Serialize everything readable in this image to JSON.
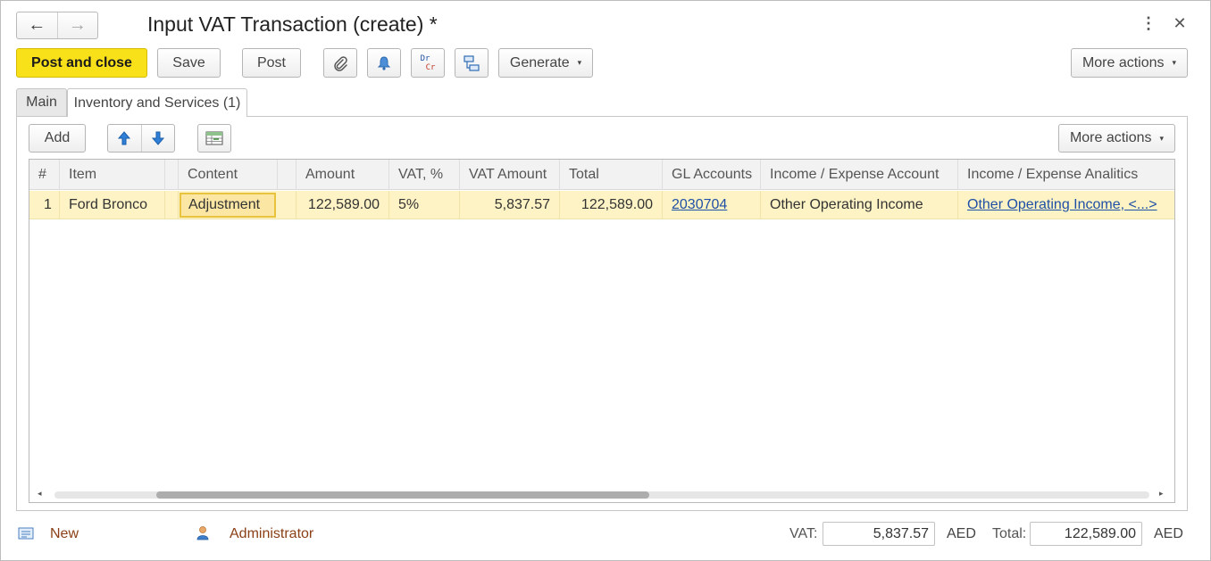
{
  "window": {
    "title": "Input VAT Transaction (create) *"
  },
  "nav": {
    "back_icon": "←",
    "forward_icon": "→",
    "more_icon": "⋮",
    "close_icon": "✕"
  },
  "toolbar": {
    "post_close": "Post and close",
    "save": "Save",
    "post": "Post",
    "dr": "Dr",
    "cr": "Cr",
    "generate": "Generate",
    "more_actions": "More actions",
    "caret": "▾"
  },
  "tabs": [
    {
      "label": "Main"
    },
    {
      "label": "Inventory and Services (1)"
    }
  ],
  "grid_toolbar": {
    "add": "Add",
    "more_actions": "More actions"
  },
  "table": {
    "headers": [
      "#",
      "Item",
      "Content",
      "Amount",
      "VAT, %",
      "VAT Amount",
      "Total",
      "GL Accounts",
      "Income / Expense Account",
      "Income / Expense Analitics"
    ],
    "rows": [
      {
        "num": "1",
        "item": "Ford Bronco",
        "content": "Adjustment",
        "amount": "122,589.00",
        "vat_pct": "5%",
        "vat_amount": "5,837.57",
        "total": "122,589.00",
        "gl_accounts": "2030704",
        "ie_account": "Other Operating Income",
        "ie_analytics": "Other Operating Income, <...>"
      }
    ]
  },
  "scroll": {
    "left": "◂",
    "right": "▸"
  },
  "footer": {
    "status": "New",
    "user": "Administrator",
    "vat_label": "VAT:",
    "vat_value": "5,837.57",
    "currency1": "AED",
    "total_label": "Total:",
    "total_value": "122,589.00",
    "currency2": "AED"
  },
  "colors": {
    "primary_button": "#f9e11a",
    "selected_row": "#fdf3c4",
    "link": "#1f4fa6",
    "footer_link": "#8a3f16"
  }
}
